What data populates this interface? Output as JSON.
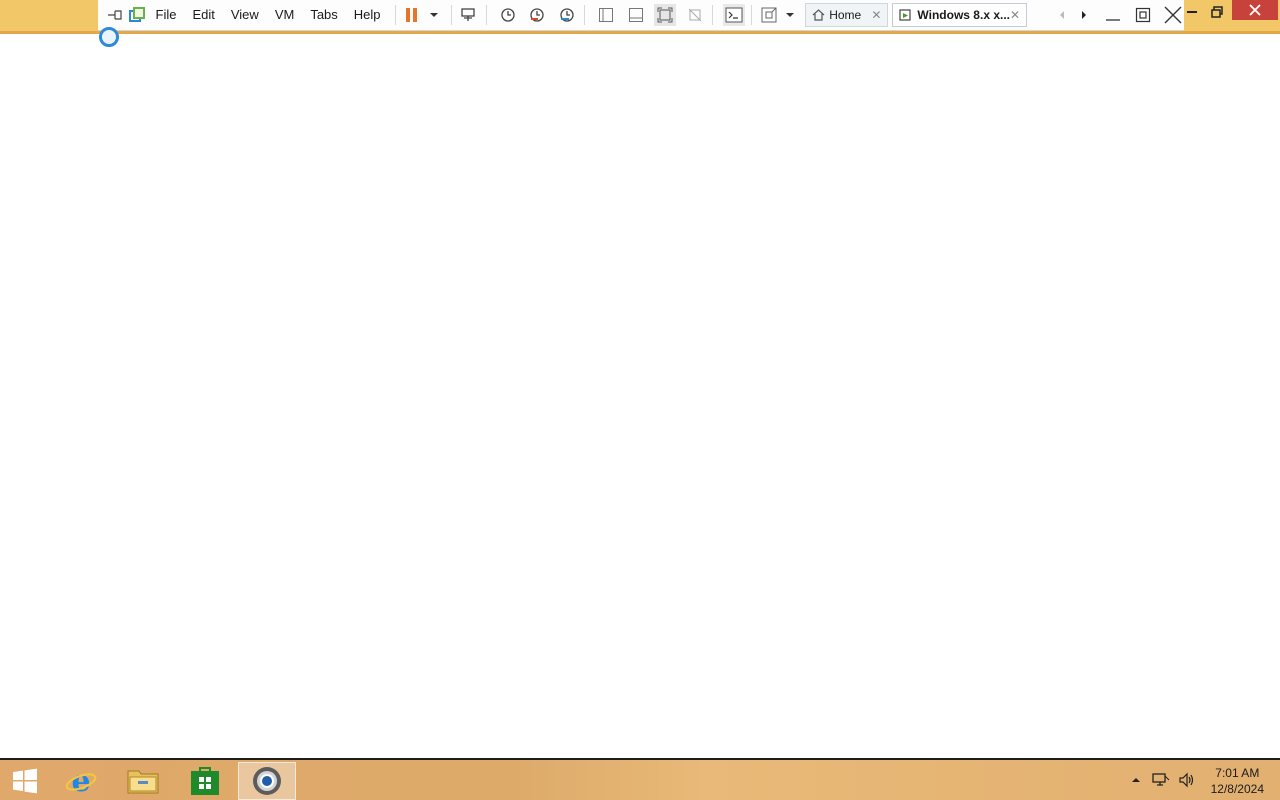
{
  "toolbar": {
    "menu": [
      "File",
      "Edit",
      "View",
      "VM",
      "Tabs",
      "Help"
    ],
    "icons": [
      "pin-icon",
      "vmware-icon",
      "pause-icon",
      "dropdown-icon",
      "send-ctrl-alt-del-icon",
      "snapshot-icon",
      "revert-snapshot-icon",
      "snapshot-manager-icon",
      "sidebar-icon",
      "thumbnail-bar-icon",
      "fullscreen-icon",
      "unity-icon",
      "console-icon",
      "stretch-icon"
    ]
  },
  "tabs": [
    {
      "label": "Home",
      "icon": "home-icon"
    },
    {
      "label": "Windows 8.x x...",
      "icon": "vm-icon"
    }
  ],
  "taskbar": {
    "apps": [
      "start-icon",
      "internet-explorer-icon",
      "file-explorer-icon",
      "store-icon",
      "chrome-icon"
    ],
    "clock": {
      "time": "7:01 AM",
      "date": "12/8/2024"
    }
  },
  "colors": {
    "titleStrip": "#f2c768",
    "pause": "#e8742a",
    "taskbar": "#e0a86a"
  }
}
